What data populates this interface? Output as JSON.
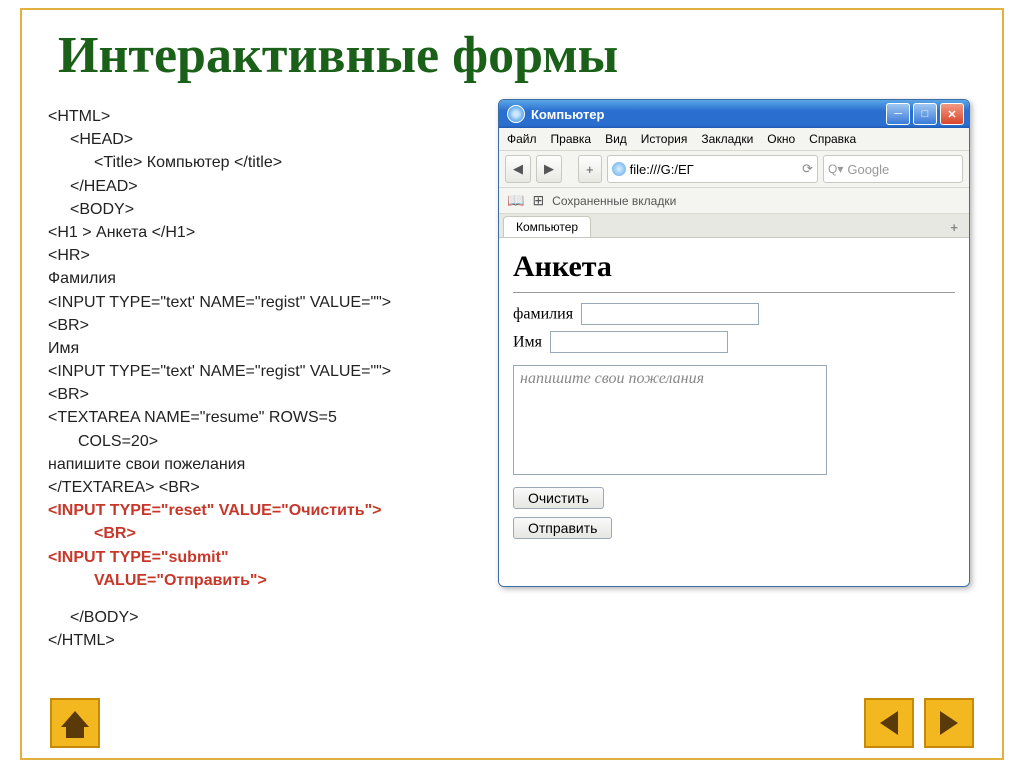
{
  "slide": {
    "title": "Интерактивные формы"
  },
  "code": {
    "l1": "<HTML>",
    "l2": "<HEAD>",
    "l3": "<Title> Компьютер </title>",
    "l4": "</HEAD>",
    "l5": "<BODY>",
    "l6": "<H1 > Анкета </H1>",
    "l7": "<HR>",
    "l8": "Фамилия",
    "l9": "<INPUT TYPE=\"text' NAME=\"regist\" VALUE=\"\">",
    "l10": "<BR>",
    "l11": "Имя",
    "l12": "<INPUT TYPE=\"text' NAME=\"regist\" VALUE=\"\">",
    "l13": "<BR>",
    "l14a": "<TEXTAREA NAME=\"resume\" ROWS=5",
    "l14b": "COLS=20>",
    "l15": "напишите свои пожелания",
    "l16": "</TEXTAREA> <BR>",
    "l17a": "<INPUT TYPE=\"reset\" VALUE=\"Очистить\">",
    "l17b": "<BR>",
    "l18a": "<INPUT TYPE=\"submit\"",
    "l18b": "VALUE=\"Отправить\">",
    "l19": "</BODY>",
    "l20": "</HTML>"
  },
  "browser": {
    "window_title": "Компьютер",
    "menus": [
      "Файл",
      "Правка",
      "Вид",
      "История",
      "Закладки",
      "Окно",
      "Справка"
    ],
    "back": "◀",
    "fwd": "▶",
    "plus": "+",
    "url": "file:///G:/ЕГ",
    "refresh": "⟳",
    "search_placeholder": "Google",
    "search_prefix": "Q▾",
    "bookmarks_label": "Сохраненные вкладки",
    "tab_label": "Компьютер",
    "tab_add": "+"
  },
  "page": {
    "heading": "Анкета",
    "label_surname": "фамилия",
    "label_name": "Имя",
    "textarea_text": "напишите свои пожелания",
    "btn_reset": "Очистить",
    "btn_submit": "Отправить"
  }
}
